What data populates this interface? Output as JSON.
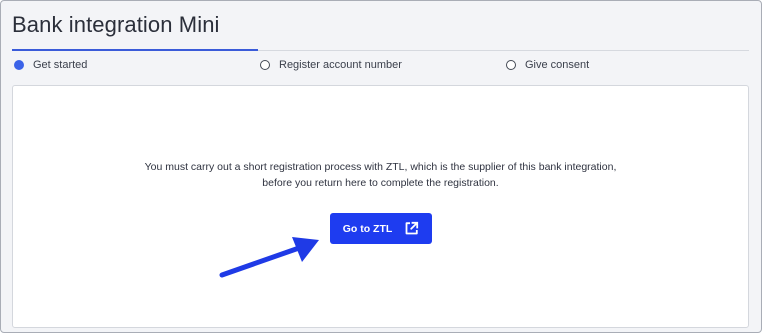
{
  "page": {
    "title": "Bank integration Mini"
  },
  "steps": [
    {
      "label": "Get started",
      "active": true
    },
    {
      "label": "Register account number",
      "active": false
    },
    {
      "label": "Give consent",
      "active": false
    }
  ],
  "content": {
    "message_line1": "You must carry out a short registration process with ZTL, which is the supplier of this bank integration,",
    "message_line2": "before you return here to complete the registration.",
    "button_label": "Go to ZTL",
    "button_icon": "external-link-icon"
  },
  "annotation": {
    "arrow_icon": "callout-arrow-icon"
  },
  "colors": {
    "accent": "#1e3cf0",
    "active_step": "#3b63e8",
    "annotation_arrow": "#1f3ae6"
  }
}
